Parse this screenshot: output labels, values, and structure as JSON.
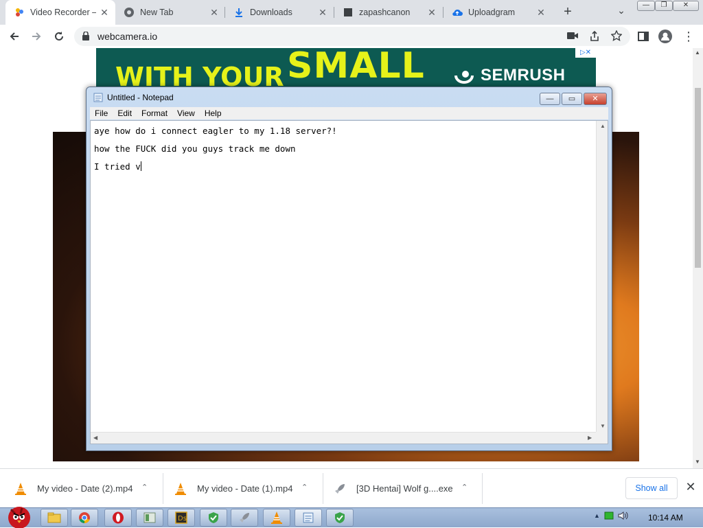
{
  "browser": {
    "tabs": [
      {
        "title": "Video Recorder –",
        "icon": "video-recorder-icon",
        "active": true
      },
      {
        "title": "New Tab",
        "icon": "chrome-icon",
        "active": false
      },
      {
        "title": "Downloads",
        "icon": "download-icon",
        "active": false
      },
      {
        "title": "zapashcanon",
        "icon": "site-icon",
        "active": false
      },
      {
        "title": "Uploadgram",
        "icon": "cloud-upload-icon",
        "active": false
      }
    ],
    "tab_close_glyph": "✕",
    "new_tab_glyph": "+",
    "tab_search_glyph": "⌄",
    "window_buttons": {
      "minimize": "—",
      "restore": "❐",
      "close": "✕"
    },
    "url": "webcamera.io"
  },
  "ad": {
    "headline": "SMALL",
    "subline": "WITH YOUR",
    "brand": "SEMRUSH",
    "ad_marker": "▷✕"
  },
  "notepad": {
    "title": "Untitled - Notepad",
    "menu": [
      "File",
      "Edit",
      "Format",
      "View",
      "Help"
    ],
    "lines": [
      "aye how do i connect eagler to my 1.18 server?!",
      "how the FUCK did you guys track me down",
      "I tried v"
    ],
    "caption_buttons": {
      "minimize": "—",
      "maximize": "▭",
      "close": "✕"
    }
  },
  "downloads": {
    "items": [
      {
        "name": "My video - Date (2).mp4",
        "icon": "vlc-cone-icon"
      },
      {
        "name": "My video - Date (1).mp4",
        "icon": "vlc-cone-icon"
      },
      {
        "name": "[3D Hentai] Wolf g....exe",
        "icon": "rocket-icon"
      }
    ],
    "chevron": "⌃",
    "show_all": "Show all",
    "close": "✕"
  },
  "taskbar": {
    "clock": "10:14 AM",
    "apps": [
      "explorer-icon",
      "chrome-icon",
      "opera-icon",
      "calculator-icon",
      "app-icon",
      "shield-icon",
      "rocket-icon",
      "vlc-cone-icon",
      "notepad-icon",
      "shield-icon"
    ]
  },
  "colors": {
    "tabstrip": "#dee1e6",
    "ad_bg": "#0d5a52",
    "ad_text": "#e6f21a",
    "link_blue": "#1a73e8"
  }
}
